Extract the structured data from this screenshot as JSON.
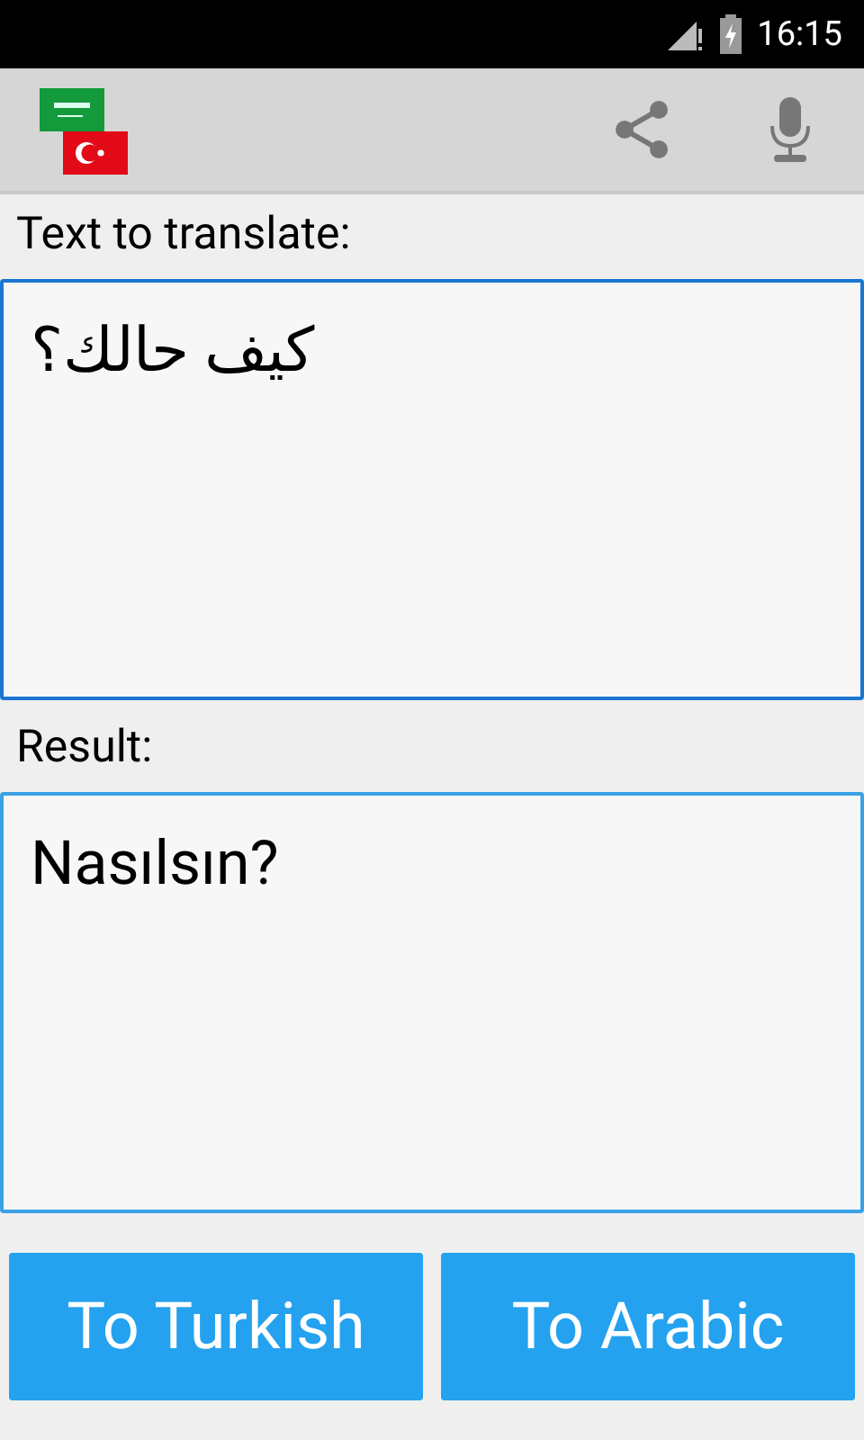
{
  "status_bar": {
    "time": "16:15"
  },
  "fields": [
    {
      "label": "Text to translate:",
      "value": "كيف حالك؟",
      "focused": true
    },
    {
      "label": "Result:",
      "value": "Nasılsın?",
      "focused": false
    }
  ],
  "buttons": [
    "To Turkish",
    "To Arabic"
  ]
}
